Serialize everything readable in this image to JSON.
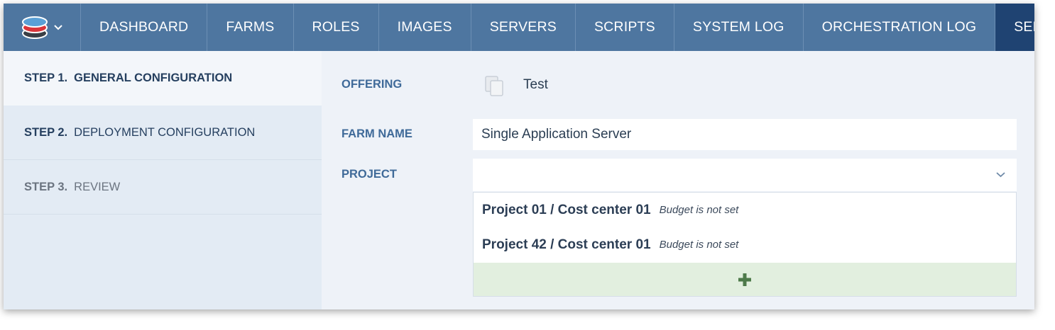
{
  "nav": {
    "items": [
      {
        "label": "DASHBOARD"
      },
      {
        "label": "FARMS"
      },
      {
        "label": "ROLES"
      },
      {
        "label": "IMAGES"
      },
      {
        "label": "SERVERS"
      },
      {
        "label": "SCRIPTS"
      },
      {
        "label": "SYSTEM LOG"
      },
      {
        "label": "ORCHESTRATION LOG"
      },
      {
        "label": "SERVIC"
      }
    ],
    "active_index": 8,
    "logo_icon": "layered-stack-logo-icon",
    "menu_icon": "chevron-down-icon"
  },
  "steps": [
    {
      "number": "STEP 1.",
      "label": "GENERAL CONFIGURATION",
      "state": "active"
    },
    {
      "number": "STEP 2.",
      "label": "DEPLOYMENT CONFIGURATION",
      "state": "enabled"
    },
    {
      "number": "STEP 3.",
      "label": "REVIEW",
      "state": "disabled"
    }
  ],
  "form": {
    "offering": {
      "label": "OFFERING",
      "value": "Test",
      "icon": "copy-icon"
    },
    "farm_name": {
      "label": "FARM NAME",
      "value": "Single Application Server"
    },
    "project": {
      "label": "PROJECT",
      "value": "",
      "icon": "chevron-down-icon",
      "options": [
        {
          "name": "Project 01 / Cost center 01",
          "budget": "Budget is not set"
        },
        {
          "name": "Project 42 / Cost center 01",
          "budget": "Budget is not set"
        }
      ],
      "add_icon": "plus-icon"
    }
  },
  "colors": {
    "nav_bg": "#4e76a0",
    "nav_active_bg": "#1f4372",
    "label_blue": "#3f6a99",
    "add_bg": "#e2efdf",
    "add_icon": "#4d7a4a"
  }
}
